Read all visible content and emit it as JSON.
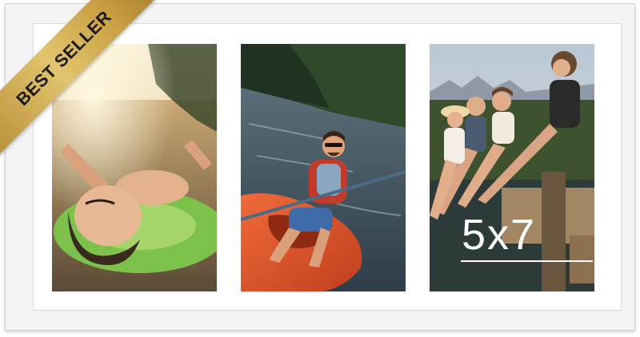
{
  "badge": {
    "text": "BEST SELLER"
  },
  "size_label": "5x7",
  "photos": [
    {
      "subject": "woman-floating-on-inflatable-ring"
    },
    {
      "subject": "man-paddling-kayak"
    },
    {
      "subject": "friends-sitting-on-dock"
    }
  ],
  "colors": {
    "frame": "#f4f4f4",
    "mat": "#ffffff",
    "badge_gold": "#c9a042",
    "badge_text": "#1b1b1b"
  }
}
